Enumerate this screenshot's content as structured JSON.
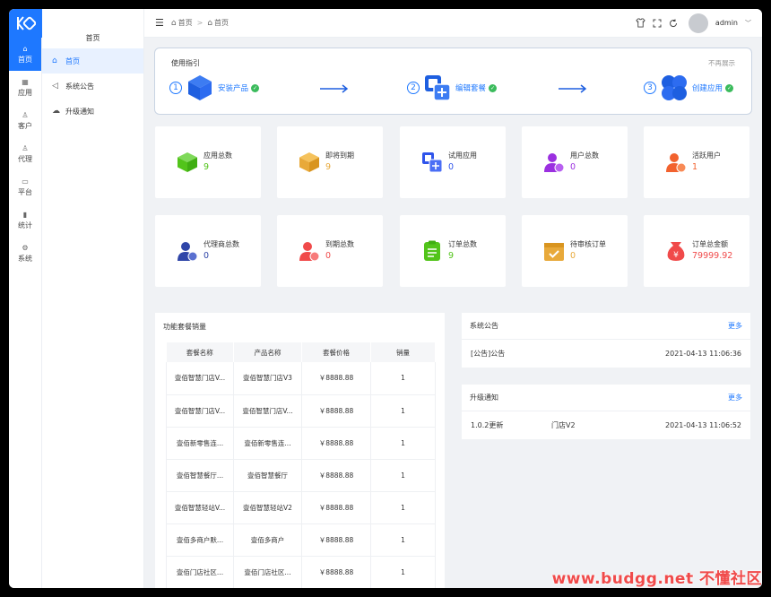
{
  "rail": {
    "items": [
      {
        "label": "首页",
        "icon": "⌂"
      },
      {
        "label": "应用",
        "icon": "▦"
      },
      {
        "label": "客户",
        "icon": "♙"
      },
      {
        "label": "代理",
        "icon": "♙"
      },
      {
        "label": "平台",
        "icon": "▭"
      },
      {
        "label": "统计",
        "icon": "▮"
      },
      {
        "label": "系统",
        "icon": "⚙"
      }
    ]
  },
  "subnav": {
    "title": "首页",
    "items": [
      {
        "label": "首页",
        "icon": "⌂"
      },
      {
        "label": "系统公告",
        "icon": "◁"
      },
      {
        "label": "升级通知",
        "icon": "☁"
      }
    ]
  },
  "header": {
    "crumbs": [
      "首页",
      "首页"
    ],
    "username": "admin"
  },
  "guide": {
    "title": "使用指引",
    "dismiss": "不再展示",
    "steps": [
      {
        "num": "1",
        "label": "安装产品"
      },
      {
        "num": "2",
        "label": "编辑套餐"
      },
      {
        "num": "3",
        "label": "创建应用"
      }
    ]
  },
  "stats": [
    {
      "label": "应用总数",
      "value": "9",
      "color": "#52c41a",
      "icon": "cube-icon"
    },
    {
      "label": "即将到期",
      "value": "9",
      "color": "#e8a93a",
      "icon": "cube-icon"
    },
    {
      "label": "试用应用",
      "value": "0",
      "color": "#2f54eb",
      "icon": "copy-icon"
    },
    {
      "label": "用户总数",
      "value": "0",
      "color": "#9b30e0",
      "icon": "user-icon"
    },
    {
      "label": "活跃用户",
      "value": "1",
      "color": "#f2622e",
      "icon": "user-icon"
    },
    {
      "label": "代理商总数",
      "value": "0",
      "color": "#2f45a8",
      "icon": "user-icon"
    },
    {
      "label": "到期总数",
      "value": "0",
      "color": "#f04a4a",
      "icon": "user-icon"
    },
    {
      "label": "订单总数",
      "value": "9",
      "color": "#52c41a",
      "icon": "document-icon"
    },
    {
      "label": "待审核订单",
      "value": "0",
      "color": "#e8a93a",
      "icon": "calendar-icon"
    },
    {
      "label": "订单总金额",
      "value": "79999.92",
      "color": "#f04a4a",
      "icon": "money-bag-icon"
    }
  ],
  "sales": {
    "title": "功能套餐销量",
    "columns": [
      "套餐名称",
      "产品名称",
      "套餐价格",
      "销量"
    ],
    "rows": [
      [
        "壹佰智慧门店V...",
        "壹佰智慧门店V3",
        "￥8888.88",
        "1"
      ],
      [
        "壹佰智慧门店V...",
        "壹佰智慧门店V...",
        "￥8888.88",
        "1"
      ],
      [
        "壹佰新零售连...",
        "壹佰新零售连...",
        "￥8888.88",
        "1"
      ],
      [
        "壹佰智慧餐厅...",
        "壹佰智慧餐厅",
        "￥8888.88",
        "1"
      ],
      [
        "壹佰智慧轻站V...",
        "壹佰智慧轻站V2",
        "￥8888.88",
        "1"
      ],
      [
        "壹佰多商户默...",
        "壹佰多商户",
        "￥8888.88",
        "1"
      ],
      [
        "壹佰门店社区...",
        "壹佰门店社区...",
        "￥8888.88",
        "1"
      ]
    ]
  },
  "announcements": {
    "title": "系统公告",
    "more": "更多",
    "items": [
      {
        "text": "[公告]公告",
        "date": "2021-04-13 11:06:36"
      }
    ]
  },
  "upgrades": {
    "title": "升级通知",
    "more": "更多",
    "items": [
      {
        "version": "1.0.2更新",
        "product": "门店V2",
        "date": "2021-04-13 11:06:52"
      }
    ]
  },
  "watermark": "www.budgg.net 不懂社区"
}
